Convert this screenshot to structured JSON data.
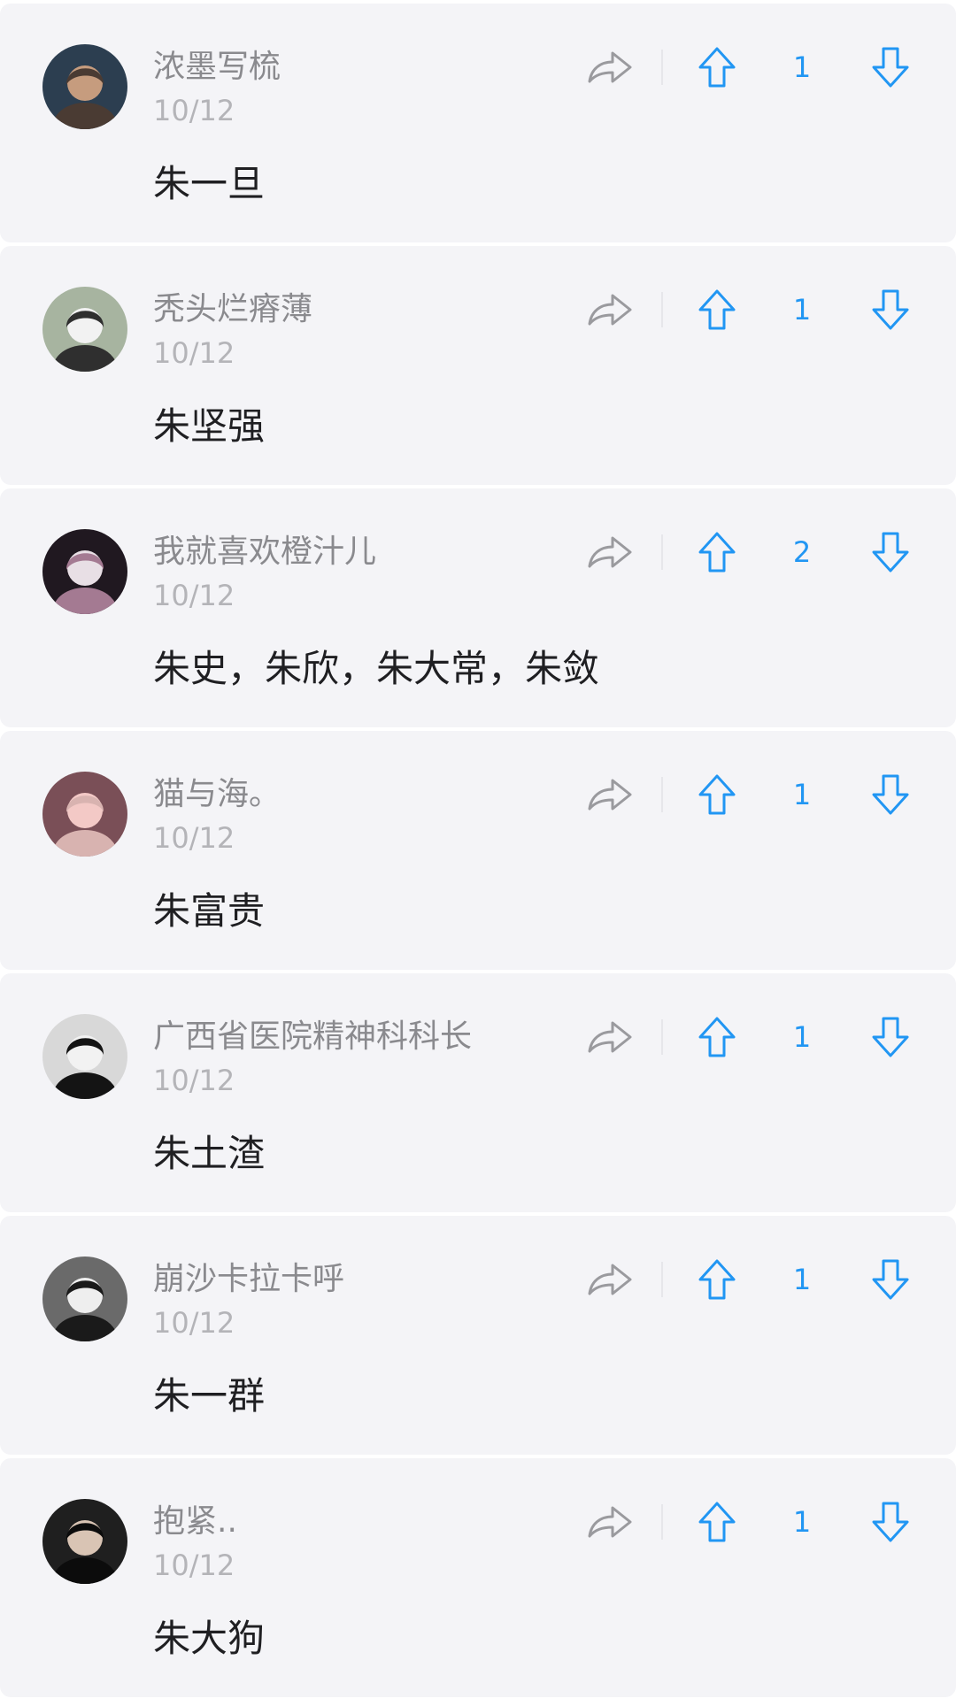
{
  "comments": [
    {
      "username": "浓墨写梳",
      "date": "10/12",
      "content": "朱一旦",
      "votes": "1",
      "avatar_palette": [
        "#2c3e50",
        "#c69c7e",
        "#4a3b33"
      ]
    },
    {
      "username": "秃头烂瘠薄",
      "date": "10/12",
      "content": "朱坚强",
      "votes": "1",
      "avatar_palette": [
        "#a7b4a0",
        "#f2f2f2",
        "#2f2f2f"
      ]
    },
    {
      "username": "我就喜欢橙汁儿",
      "date": "10/12",
      "content": "朱史，朱欣，朱大常，朱敛",
      "votes": "2",
      "avatar_palette": [
        "#201820",
        "#e8dfe5",
        "#a47a92"
      ]
    },
    {
      "username": "猫与海。",
      "date": "10/12",
      "content": "朱富贵",
      "votes": "1",
      "avatar_palette": [
        "#7a4f57",
        "#f3c9c6",
        "#d8b3b0"
      ]
    },
    {
      "username": "广西省医院精神科科长",
      "date": "10/12",
      "content": "朱土渣",
      "votes": "1",
      "avatar_palette": [
        "#d8d8d8",
        "#f2f2f2",
        "#141414"
      ]
    },
    {
      "username": "崩沙卡拉卡呼",
      "date": "10/12",
      "content": "朱一群",
      "votes": "1",
      "avatar_palette": [
        "#6a6a6a",
        "#eeeeee",
        "#1a1a1a"
      ]
    },
    {
      "username": "抱紧..",
      "date": "10/12",
      "content": "朱大狗",
      "votes": "1",
      "avatar_palette": [
        "#1f1f1f",
        "#d9c4b4",
        "#0c0c0c"
      ]
    }
  ],
  "icons": {
    "share": "share-icon",
    "upvote": "upvote-arrow-icon",
    "downvote": "downvote-arrow-icon"
  },
  "colors": {
    "accent": "#2196f3",
    "card_background": "#f4f4f7",
    "username": "#8a8a8e",
    "date": "#b4b4b8",
    "content": "#1f1f22",
    "share_icon": "#9a9a9e"
  }
}
